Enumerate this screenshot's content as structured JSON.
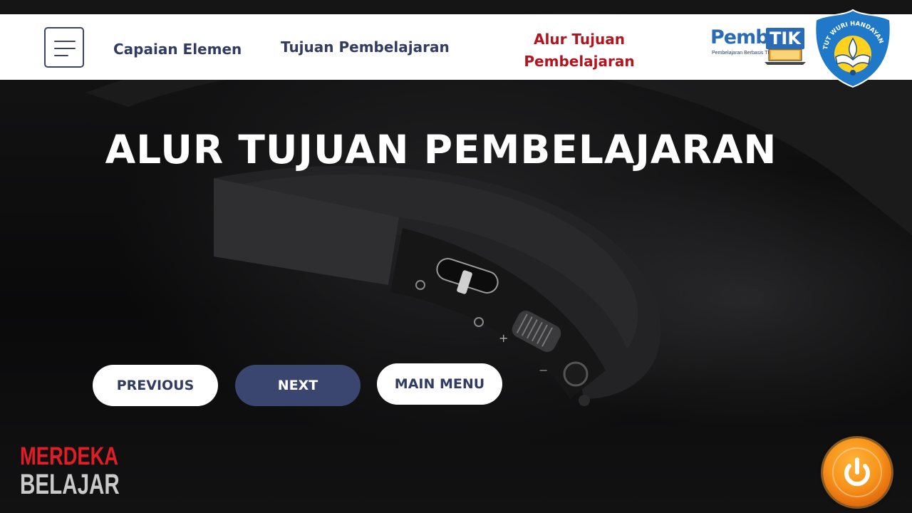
{
  "nav": {
    "menu_icon": "hamburger-menu-icon",
    "links": [
      {
        "label": "Capaian Elemen",
        "active": false
      },
      {
        "label": "Tujuan Pembelajaran",
        "active": false
      },
      {
        "label": "Alur Tujuan Pembelajaran",
        "active": true
      }
    ],
    "active_color": "#b3151f",
    "link_color": "#323c63"
  },
  "logos": {
    "pembatik": {
      "brand": "Pemba",
      "tik": "TIK",
      "tagline": "Pembelajaran Berbasis TIK"
    },
    "emblem_text": "TUT WURI HANDAYANI",
    "merdeka_line1": "MERDEKA",
    "merdeka_line2": "BELAJAR"
  },
  "main": {
    "title": "ALUR TUJUAN PEMBELAJARAN"
  },
  "buttons": {
    "previous": "PREVIOUS",
    "next": "NEXT",
    "main_menu": "MAIN MENU"
  },
  "power_button": {
    "icon": "power-icon",
    "color": "#f7931a"
  }
}
